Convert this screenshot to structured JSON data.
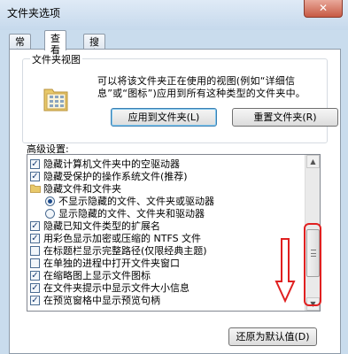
{
  "window": {
    "title": "文件夹选项",
    "close_label": "✕"
  },
  "tabs": [
    {
      "label": "常规",
      "active": false
    },
    {
      "label": "查看",
      "active": true
    },
    {
      "label": "搜索",
      "active": false
    }
  ],
  "folder_views": {
    "legend": "文件夹视图",
    "description": "可以将该文件夹正在使用的视图(例如“详细信息”或“图标”)应用到所有这种类型的文件夹中。",
    "apply_button": "应用到文件夹(L)",
    "reset_button": "重置文件夹(R)"
  },
  "advanced": {
    "label": "高级设置:",
    "items": [
      {
        "type": "checkbox",
        "checked": true,
        "label": "隐藏计算机文件夹中的空驱动器"
      },
      {
        "type": "checkbox",
        "checked": true,
        "label": "隐藏受保护的操作系统文件(推荐)"
      },
      {
        "type": "folder",
        "label": "隐藏文件和文件夹"
      },
      {
        "type": "radio",
        "checked": true,
        "label": "不显示隐藏的文件、文件夹或驱动器"
      },
      {
        "type": "radio",
        "checked": false,
        "label": "显示隐藏的文件、文件夹和驱动器"
      },
      {
        "type": "checkbox",
        "checked": true,
        "label": "隐藏已知文件类型的扩展名"
      },
      {
        "type": "checkbox",
        "checked": true,
        "label": "用彩色显示加密或压缩的 NTFS 文件"
      },
      {
        "type": "checkbox",
        "checked": false,
        "label": "在标题栏显示完整路径(仅限经典主题)"
      },
      {
        "type": "checkbox",
        "checked": false,
        "label": "在单独的进程中打开文件夹窗口"
      },
      {
        "type": "checkbox",
        "checked": true,
        "label": "在缩略图上显示文件图标"
      },
      {
        "type": "checkbox",
        "checked": true,
        "label": "在文件夹提示中显示文件大小信息"
      },
      {
        "type": "checkbox",
        "checked": true,
        "label": "在预览窗格中显示预览句柄"
      }
    ],
    "restore_button": "还原为默认值(D)"
  },
  "icons": {
    "close": "close-icon",
    "folder_view": "folder-view-icon",
    "folder": "folder-icon",
    "scroll_arrow": "red-down-arrow-icon"
  },
  "colors": {
    "highlight": "#e02020",
    "checkmark": "#1c3f74",
    "titlebar": "#c6d9ec"
  }
}
